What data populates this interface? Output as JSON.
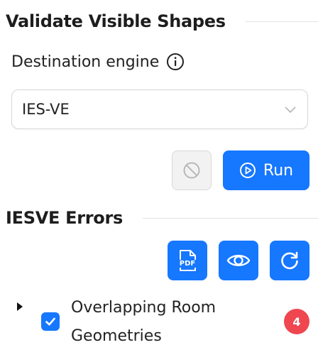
{
  "validate": {
    "title": "Validate Visible Shapes",
    "engine_label": "Destination engine",
    "engine_info_icon": "info-icon",
    "engine_value": "IES-VE",
    "cancel_icon": "ban-icon",
    "run_label": "Run",
    "run_icon": "play-circle-icon"
  },
  "errors": {
    "title": "IESVE Errors",
    "toolbar": {
      "pdf_icon": "pdf-file-icon",
      "pdf_text": "PDF",
      "eye_icon": "eye-icon",
      "refresh_icon": "refresh-icon"
    },
    "items": [
      {
        "label": "Overlapping Room Geometries",
        "checked": true,
        "count": "4"
      }
    ]
  },
  "colors": {
    "primary": "#1677ff",
    "badge": "#ef4650",
    "disabled_bg": "#f2f2f2"
  }
}
